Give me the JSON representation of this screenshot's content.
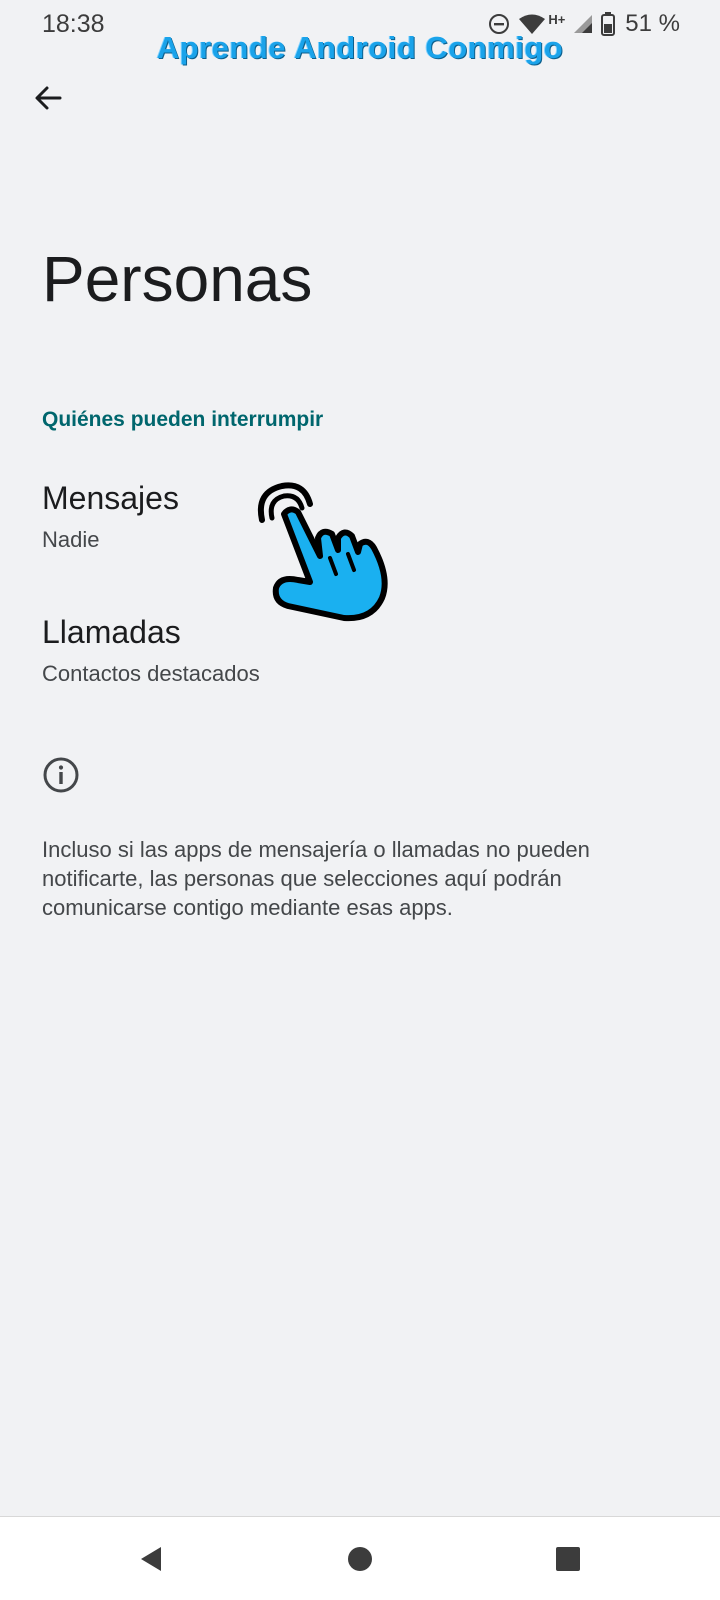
{
  "status_bar": {
    "time": "18:38",
    "network_type": "H+",
    "battery_percent": "51 %",
    "icons": [
      "do-not-disturb-icon",
      "wifi-icon",
      "signal-icon",
      "battery-icon"
    ]
  },
  "watermark": "Aprende Android Conmigo",
  "header": {
    "back_icon": "arrow-back-icon",
    "title": "Personas"
  },
  "section": {
    "header": "Quiénes pueden interrumpir"
  },
  "items": [
    {
      "title": "Mensajes",
      "summary": "Nadie"
    },
    {
      "title": "Llamadas",
      "summary": "Contactos destacados"
    }
  ],
  "info": {
    "icon": "info-icon",
    "text": "Incluso si las apps de mensajería o llamadas no pueden notificarte, las personas que selecciones aquí podrán comunicarse contigo mediante esas apps."
  },
  "overlay": {
    "icon": "hand-pointer-icon",
    "color": "#1ab0f0"
  },
  "nav_bar": {
    "icons": [
      "nav-back-icon",
      "nav-home-icon",
      "nav-recents-icon"
    ]
  },
  "colors": {
    "background": "#f1f2f4",
    "accent": "#00666d",
    "watermark": "#1aa3ea"
  }
}
